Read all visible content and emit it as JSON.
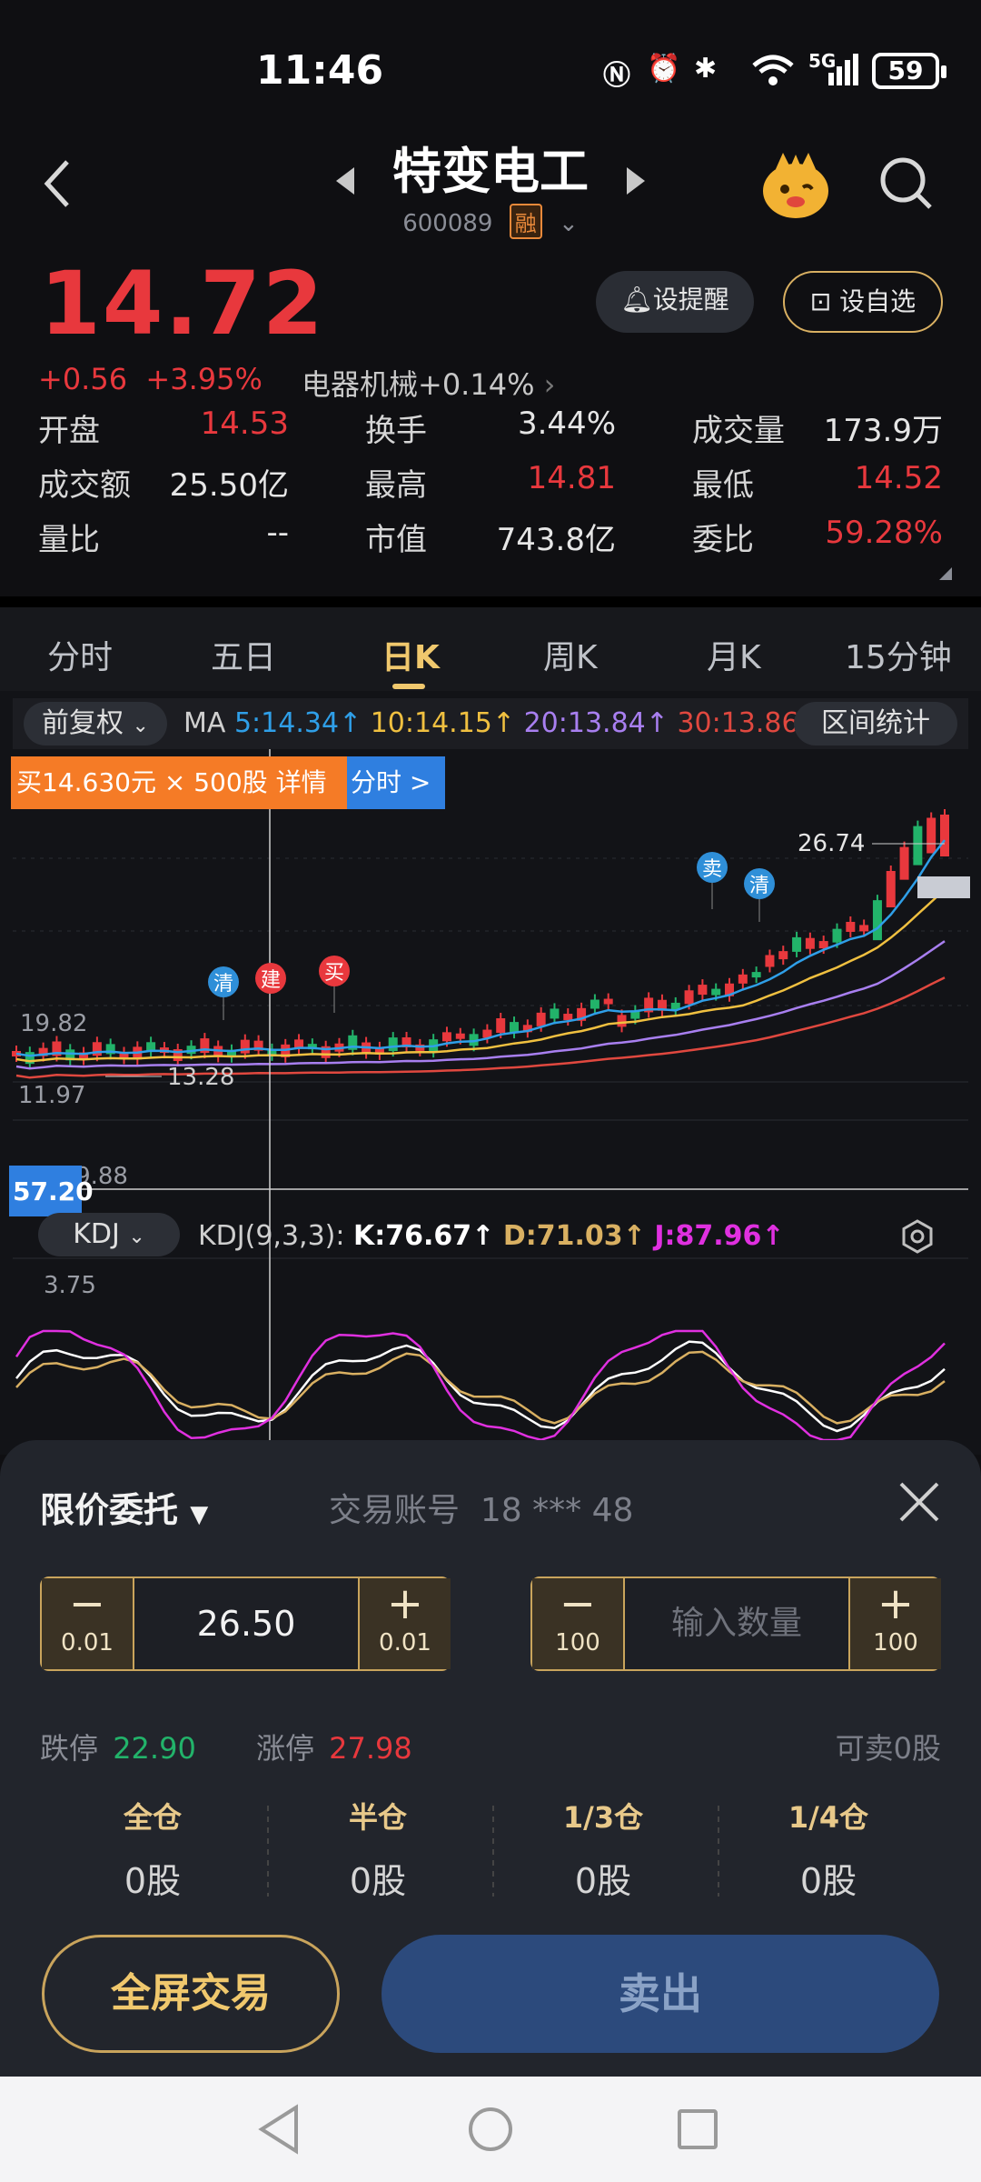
{
  "status": {
    "time": "11:46",
    "battery": "59",
    "signal": "5G"
  },
  "header": {
    "title": "特变电工",
    "code": "600089",
    "badge": "融"
  },
  "quote": {
    "price": "14.72",
    "change": "+0.56",
    "change_pct": "+3.95%",
    "sector": "电器机械+0.14%",
    "alert_label": "设提醒",
    "watch_label": "设自选",
    "fields": [
      {
        "label": "开盘",
        "value": "14.53",
        "color": "#e8383d"
      },
      {
        "label": "换手",
        "value": "3.44%",
        "color": "#e6e6e6"
      },
      {
        "label": "成交量",
        "value": "173.9万",
        "color": "#e6e6e6"
      },
      {
        "label": "成交额",
        "value": "25.50亿",
        "color": "#e6e6e6"
      },
      {
        "label": "最高",
        "value": "14.81",
        "color": "#e8383d"
      },
      {
        "label": "最低",
        "value": "14.52",
        "color": "#e8383d"
      },
      {
        "label": "量比",
        "value": "--",
        "color": "#e6e6e6"
      },
      {
        "label": "市值",
        "value": "743.8亿",
        "color": "#e6e6e6"
      },
      {
        "label": "委比",
        "value": "59.28%",
        "color": "#e8383d"
      }
    ]
  },
  "tabs": [
    "分时",
    "五日",
    "日K",
    "周K",
    "月K",
    "15分钟"
  ],
  "active_tab": "日K",
  "chart": {
    "adjust_label": "前复权",
    "ma_prefix": "MA",
    "ma5": "5:14.34↑",
    "ma10": "10:14.15↑",
    "ma20": "20:13.84↑",
    "ma30": "30:13.86↑",
    "range_label": "区间统计",
    "trade_tip": "买14.630元 × 500股 详情",
    "fenshi_tip": "分时 >",
    "max_label": "26.74",
    "mid_label": "19.82",
    "low_label": "11.97",
    "min_label": "13.28",
    "markers": [
      "清",
      "建",
      "买",
      "卖",
      "清"
    ],
    "kdj_label": "KDJ",
    "kdj_params": "KDJ(9,3,3):",
    "kdj_k": "K:76.67↑",
    "kdj_d": "D:71.03↑",
    "kdj_j": "J:87.96↑",
    "kdj_top": "109.88",
    "kdj_cross": "57.20",
    "kdj_bottom": "3.75",
    "colors": {
      "ma5": "#2f9fe8",
      "ma10": "#f0c040",
      "ma20": "#a87ff0",
      "ma30": "#e0483f",
      "up": "#e8383d",
      "down": "#22b36a"
    }
  },
  "order": {
    "type_label": "限价委托",
    "account_label": "交易账号",
    "account_value": "18 *** 48",
    "price_value": "26.50",
    "price_minus_sub": "0.01",
    "price_plus_sub": "0.01",
    "qty_placeholder": "输入数量",
    "qty_minus_sub": "100",
    "qty_plus_sub": "100",
    "limit_down_label": "跌停",
    "limit_down_value": "22.90",
    "limit_up_label": "涨停",
    "limit_up_value": "27.98",
    "sellable": "可卖0股",
    "positions": [
      {
        "label": "全仓",
        "amount": "0股"
      },
      {
        "label": "半仓",
        "amount": "0股"
      },
      {
        "label": "1/3仓",
        "amount": "0股"
      },
      {
        "label": "1/4仓",
        "amount": "0股"
      }
    ],
    "fullscreen_label": "全屏交易",
    "sell_label": "卖出"
  }
}
